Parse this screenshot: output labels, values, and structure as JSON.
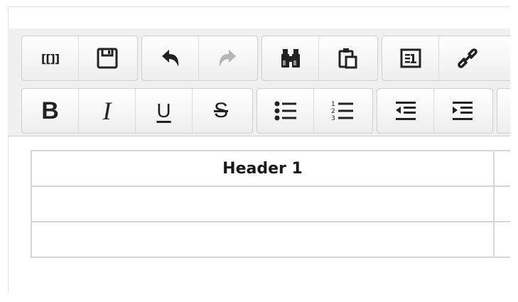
{
  "toolbar": {
    "row1": [
      {
        "name": "wiki-markup-button",
        "text": "[[]]"
      },
      {
        "name": "save-button",
        "icon": "save-icon"
      },
      {
        "name": "undo-button",
        "icon": "undo-icon"
      },
      {
        "name": "redo-button",
        "icon": "redo-icon"
      },
      {
        "name": "find-button",
        "icon": "binoculars-icon"
      },
      {
        "name": "paste-button",
        "icon": "clipboard-icon"
      },
      {
        "name": "insert-id-button",
        "icon": "id-card-icon"
      },
      {
        "name": "link-button",
        "icon": "link-icon"
      }
    ],
    "row2": [
      {
        "name": "bold-button",
        "text": "B"
      },
      {
        "name": "italic-button",
        "text": "I"
      },
      {
        "name": "underline-button",
        "text": "U"
      },
      {
        "name": "strikethrough-button",
        "text": "S"
      },
      {
        "name": "bulleted-list-button",
        "icon": "bulleted-list-icon"
      },
      {
        "name": "numbered-list-button",
        "icon": "numbered-list-icon"
      },
      {
        "name": "outdent-button",
        "icon": "outdent-icon"
      },
      {
        "name": "indent-button",
        "icon": "indent-icon"
      }
    ],
    "wiki_label": "[[]]",
    "bold_label": "B",
    "italic_label": "I",
    "underline_label": "U",
    "strike_label": "S"
  },
  "table": {
    "headers": [
      "Header 1",
      ""
    ],
    "rows": [
      [
        "",
        ""
      ],
      [
        "",
        ""
      ]
    ]
  },
  "colors": {
    "toolbar_bg": "#f0f0f0",
    "icon": "#222222",
    "icon_disabled": "#b5b5b5",
    "border": "#d6d6d6"
  }
}
